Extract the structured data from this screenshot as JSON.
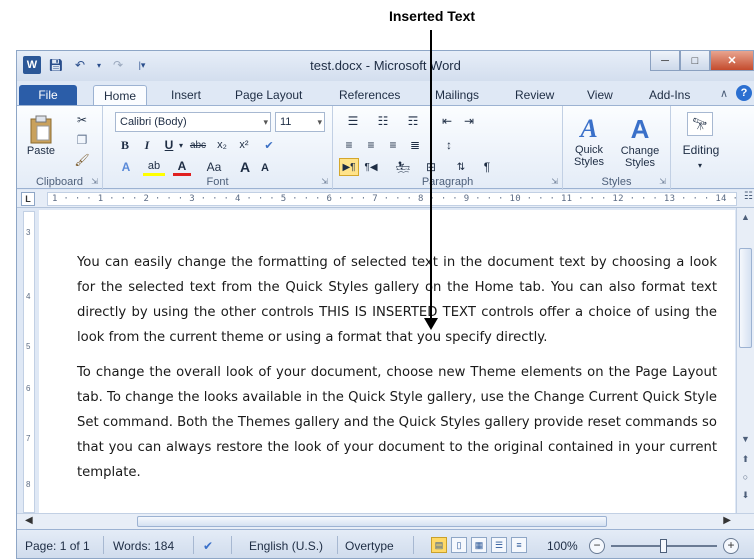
{
  "annotation": {
    "label": "Inserted Text"
  },
  "window": {
    "title": "test.docx - Microsoft Word",
    "qat": {
      "logo": "W"
    }
  },
  "tabs": [
    "File",
    "Home",
    "Insert",
    "Page Layout",
    "References",
    "Mailings",
    "Review",
    "View",
    "Add-Ins"
  ],
  "ribbon": {
    "clipboard": {
      "paste": "Paste",
      "label": "Clipboard"
    },
    "font": {
      "name": "Calibri (Body)",
      "size": "11",
      "label": "Font",
      "grow": "A",
      "shrink": "A",
      "case": "Aa"
    },
    "paragraph": {
      "label": "Paragraph",
      "pilcrow": "¶"
    },
    "styles": {
      "quick": "Quick\nStyles",
      "change": "Change\nStyles",
      "label": "Styles"
    },
    "editing": {
      "label": "Editing"
    }
  },
  "ruler": {
    "ticks": "1 · · · 1 · · · 2 · · · 3 · · · 4 · · · 5 · · · 6 · · · 7 · · · 8 · · · 9 · · · 10 · · · 11 · · · 12 · · · 13 · · · 14 · · △ 15",
    "corner": "L"
  },
  "document": {
    "para1": "You can easily change the formatting of selected text in the document text by choosing a look for the selected text from the Quick Styles gallery on the Home tab. You can also format text directly by using the other controls THIS IS INSERTED TEXT controls offer a choice of using the look from the current theme or using a format that you specify directly.",
    "para2": "To change the overall look of your document, choose new Theme elements on the Page Layout tab. To change the looks available in the Quick Style gallery, use the Change Current Quick Style Set command. Both the Themes gallery and the Quick Styles gallery provide reset commands so that you can always restore the look of your document to the original contained in your current template."
  },
  "status": {
    "page": "Page: 1 of 1",
    "words": "Words: 184",
    "language": "English (U.S.)",
    "mode": "Overtype",
    "zoom": "100%",
    "zoom_level": 100
  }
}
